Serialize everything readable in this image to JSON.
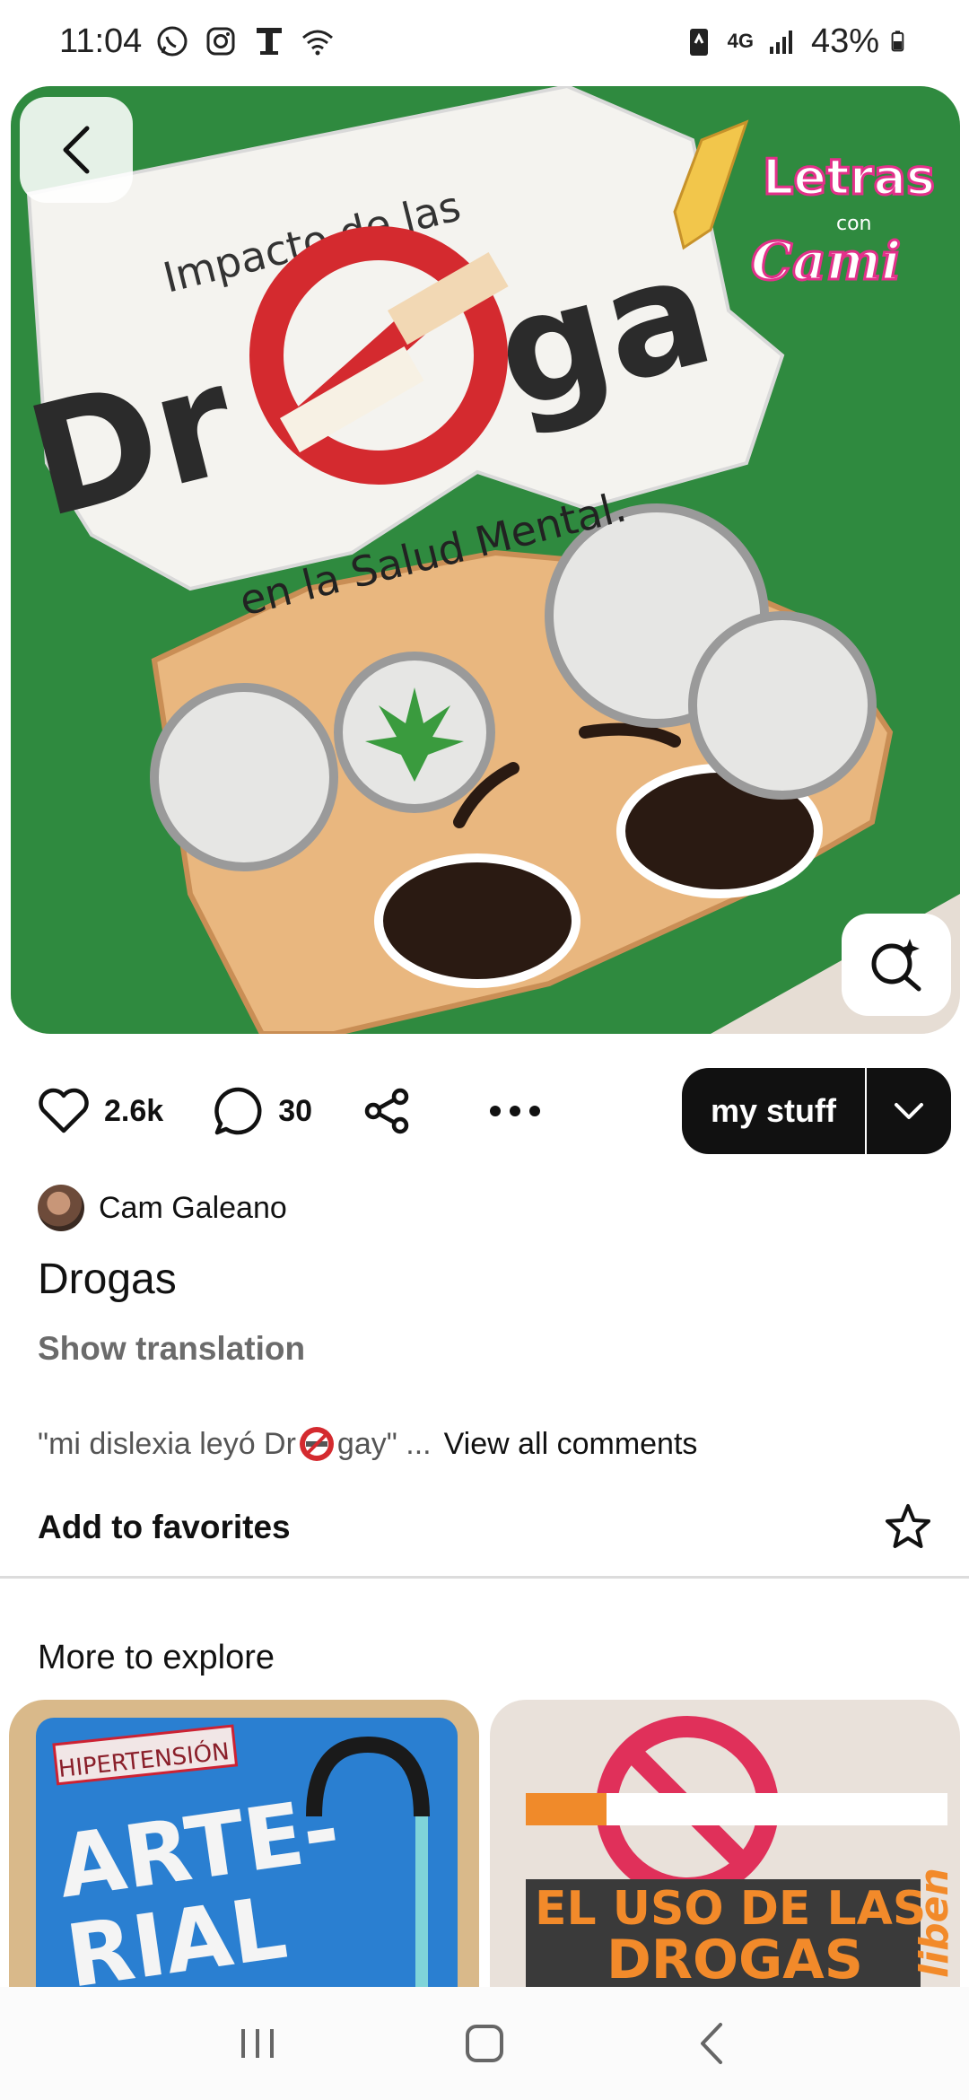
{
  "status_bar": {
    "time": "11:04",
    "network": "4G",
    "battery": "43%"
  },
  "pin": {
    "image_overlay_text": {
      "line1": "Impacto de las",
      "word_left": "Dr",
      "word_right": "ga",
      "line3": "en la Salud Mental.",
      "watermark_1": "Letras",
      "watermark_con": "con",
      "watermark_2": "Cami"
    },
    "likes": "2.6k",
    "comments": "30",
    "save_label": "my stuff",
    "author": "Cam Galeano",
    "title": "Drogas",
    "show_translation": "Show translation",
    "comment_preview_start": "\"mi dislexia leyó Dr",
    "comment_preview_end": " gay\" ...",
    "view_all_comments": "View all comments",
    "add_to_favorites": "Add to favorites"
  },
  "explore": {
    "title": "More to explore",
    "tiles": [
      {
        "label_top": "HIPERTENSIÓN",
        "big_text_1": "ARTE-",
        "big_text_2": "RIAL"
      },
      {
        "big_text_1": "EL USO DE LAS",
        "big_text_2": "DROGAS",
        "side_text": "liben"
      }
    ]
  },
  "colors": {
    "save_button_bg": "#111111",
    "hero_green": "#2e8b3e",
    "no_sign_red": "#d42a2f",
    "skin": "#e9b77f"
  }
}
